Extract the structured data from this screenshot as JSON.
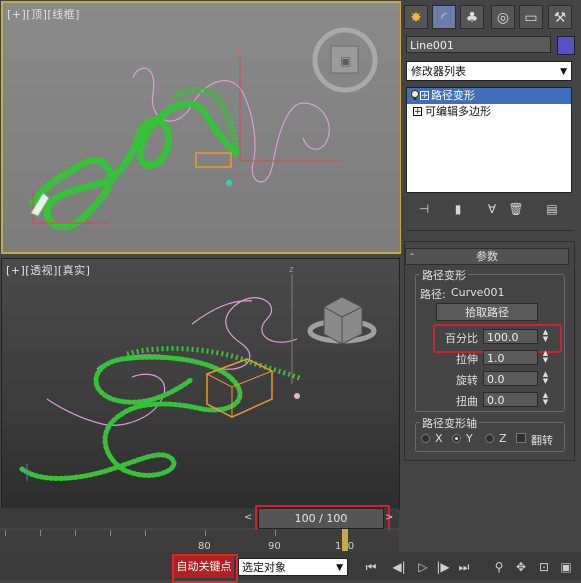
{
  "viewports": {
    "top": {
      "label": "[+][顶][线框]"
    },
    "perspective": {
      "label": "[+][透视][真实]"
    }
  },
  "axes": {
    "x": "x",
    "y": "y",
    "z": "z"
  },
  "timeline": {
    "slider_text": "100 / 100",
    "prev": "<",
    "next": ">"
  },
  "ruler": {
    "labels": [
      "80",
      "90",
      "100"
    ]
  },
  "statusbar": {
    "autokey": "自动关键点",
    "selection_filter": "选定对象",
    "playback_icons": [
      "key-mode-icon",
      "prev-frame-icon",
      "play-icon",
      "next-frame-icon",
      "last-frame-icon",
      "zoom-icon",
      "pan-icon",
      "zoom-extents-icon",
      "maximize-icon"
    ]
  },
  "command_panel": {
    "tabs": [
      "create-tab-icon",
      "modify-tab-icon",
      "hierarchy-tab-icon",
      "motion-tab-icon",
      "display-tab-icon",
      "utilities-tab-icon"
    ],
    "object_name": "Line001",
    "object_color": "#5552c8",
    "modifier_list": "修改器列表",
    "stack": [
      {
        "label": "路径变形",
        "selected": true
      },
      {
        "label": "可编辑多边形",
        "selected": false
      }
    ],
    "stack_buttons": [
      "pin-stack-icon",
      "show-end-result-icon",
      "make-unique-icon",
      "remove-modifier-icon",
      "configure-sets-icon"
    ],
    "rollout": {
      "title": "参数",
      "minus": "-",
      "group_title": "路径变形",
      "path_label": "路径:",
      "path_value": "Curve001",
      "pick_button": "拾取路径",
      "params": [
        {
          "label": "百分比",
          "value": "100.0"
        },
        {
          "label": "拉伸",
          "value": "1.0"
        },
        {
          "label": "旋转",
          "value": "0.0"
        },
        {
          "label": "扭曲",
          "value": "0.0"
        }
      ],
      "axis_group_title": "路径变形轴",
      "axis_options": [
        {
          "label": "X",
          "selected": false
        },
        {
          "label": "Y",
          "selected": true
        },
        {
          "label": "Z",
          "selected": false
        }
      ],
      "flip_label": "翻转",
      "flip_checked": false
    }
  }
}
